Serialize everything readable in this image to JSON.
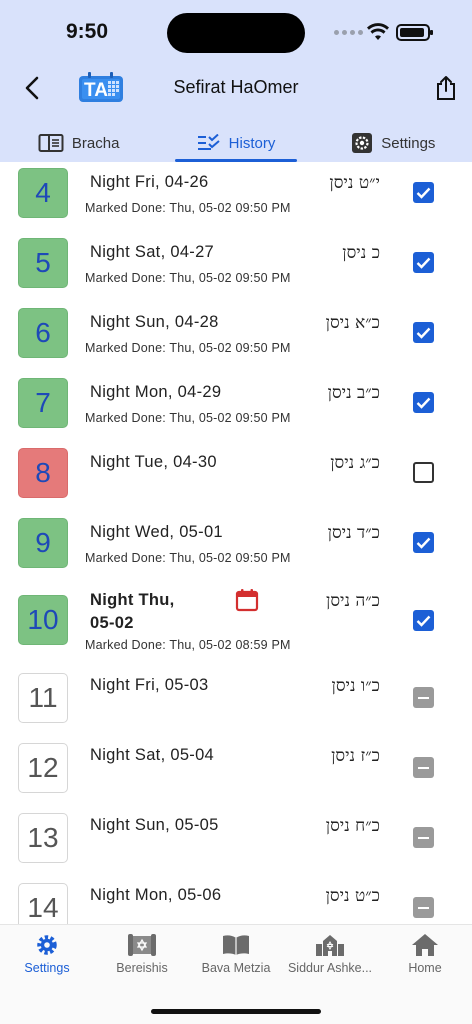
{
  "status": {
    "time": "9:50"
  },
  "nav": {
    "title": "Sefirat HaOmer"
  },
  "tabs": [
    {
      "label": "Bracha",
      "icon": "book-icon",
      "active": false
    },
    {
      "label": "History",
      "icon": "checklist-icon",
      "active": true
    },
    {
      "label": "Settings",
      "icon": "gear-icon",
      "active": false
    }
  ],
  "rows": [
    {
      "day": "4",
      "night": "Night Fri, 04-26",
      "hebrew": "י״ט ניסן",
      "marked": "Marked Done: Thu, 05-02 09:50 PM",
      "state": "done",
      "check": "checked"
    },
    {
      "day": "5",
      "night": "Night Sat, 04-27",
      "hebrew": "כ ניסן",
      "marked": "Marked Done: Thu, 05-02 09:50 PM",
      "state": "done",
      "check": "checked"
    },
    {
      "day": "6",
      "night": "Night Sun, 04-28",
      "hebrew": "כ״א ניסן",
      "marked": "Marked Done: Thu, 05-02 09:50 PM",
      "state": "done",
      "check": "checked"
    },
    {
      "day": "7",
      "night": "Night Mon, 04-29",
      "hebrew": "כ״ב ניסן",
      "marked": "Marked Done: Thu, 05-02 09:50 PM",
      "state": "done",
      "check": "checked"
    },
    {
      "day": "8",
      "night": "Night Tue, 04-30",
      "hebrew": "כ״ג ניסן",
      "marked": "",
      "state": "missed",
      "check": "unchecked"
    },
    {
      "day": "9",
      "night": "Night Wed, 05-01",
      "hebrew": "כ״ד ניסן",
      "marked": "Marked Done: Thu, 05-02 09:50 PM",
      "state": "done",
      "check": "checked"
    },
    {
      "day": "10",
      "night_line1": "Night Thu,",
      "night_line2": "05-02",
      "hebrew": "כ״ה ניסן",
      "marked": "Marked Done: Thu, 05-02 08:59 PM",
      "state": "done",
      "check": "checked",
      "today": true
    },
    {
      "day": "11",
      "night": "Night Fri, 05-03",
      "hebrew": "כ״ו ניסן",
      "marked": "",
      "state": "future",
      "check": "disabled"
    },
    {
      "day": "12",
      "night": "Night Sat, 05-04",
      "hebrew": "כ״ז ניסן",
      "marked": "",
      "state": "future",
      "check": "disabled"
    },
    {
      "day": "13",
      "night": "Night Sun, 05-05",
      "hebrew": "כ״ח ניסן",
      "marked": "",
      "state": "future",
      "check": "disabled"
    },
    {
      "day": "14",
      "night": "Night Mon, 05-06",
      "hebrew": "כ״ט ניסן",
      "marked": "",
      "state": "future",
      "check": "disabled"
    }
  ],
  "bottom_nav": [
    {
      "label": "Settings",
      "icon": "gear-icon",
      "active": true
    },
    {
      "label": "Bereishis",
      "icon": "torah-icon",
      "active": false
    },
    {
      "label": "Bava Metzia",
      "icon": "open-book-icon",
      "active": false
    },
    {
      "label": "Siddur Ashke...",
      "icon": "synagogue-icon",
      "active": false
    },
    {
      "label": "Home",
      "icon": "home-icon",
      "active": false
    }
  ],
  "colors": {
    "accent": "#1c5fd6",
    "header_bg": "#d9e2fb",
    "done_green": "#7dc283",
    "missed_red": "#e57a7a",
    "calendar_red": "#d32f2f"
  }
}
